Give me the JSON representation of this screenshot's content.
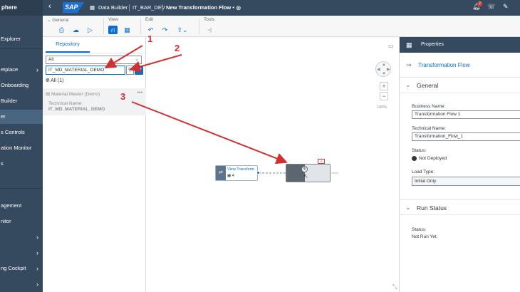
{
  "shell": {
    "app_name": "phere",
    "logo_text": "SAP",
    "crumbs": [
      "Data Builder",
      "IT_BAR_DEV",
      "New Transformation Flow •"
    ],
    "notification_count": "2"
  },
  "left_nav": {
    "items": [
      {
        "label": "Explorer"
      },
      {
        "label": "etplace"
      },
      {
        "label": "Onboarding"
      },
      {
        "label": "Builder"
      },
      {
        "label": "er"
      },
      {
        "label": "s Controls"
      },
      {
        "label": "ation Monitor"
      },
      {
        "label": "s"
      },
      {
        "label": "agement"
      },
      {
        "label": "nitor"
      },
      {
        "label": ""
      },
      {
        "label": ""
      },
      {
        "label": "ng Cockpit"
      },
      {
        "label": ""
      }
    ]
  },
  "toolbar": {
    "general_label": "General",
    "view_label": "View",
    "edit_label": "Edit",
    "tools_label": "Tools"
  },
  "repository": {
    "tab_label": "Repository",
    "filter_value": "All",
    "search_value": "IT_MD_MATERIAL_DEMO",
    "results_label": "All (1)",
    "item": {
      "name": "Material Master (Demo)",
      "tech_label": "Technical Name:",
      "tech_value": "IT_MD_MATERIAL_DEMO"
    }
  },
  "canvas": {
    "zoom_level": "100%",
    "view_transform_label": "View Transform",
    "view_transform_count": "4",
    "target_badge": "1"
  },
  "properties": {
    "header": "Properties",
    "object_title": "Transformation Flow",
    "general_section": "General",
    "business_name_label": "Business Name:",
    "business_name_value": "Transformation Flow 1",
    "technical_name_label": "Technical Name:",
    "technical_name_value": "Transformation_Flow_1",
    "status_label": "Status:",
    "status_value": "Not Deployed",
    "load_type_label": "Load Type:",
    "load_type_value": "Initial Only",
    "run_status_section": "Run Status",
    "run_status_label": "Status:",
    "run_status_value": "Not Run Yet"
  },
  "annotations": [
    "1",
    "2",
    "3"
  ],
  "colors": {
    "shell_bg": "#354a5f",
    "accent": "#0a6ed1",
    "annotation": "#d32f2f"
  }
}
